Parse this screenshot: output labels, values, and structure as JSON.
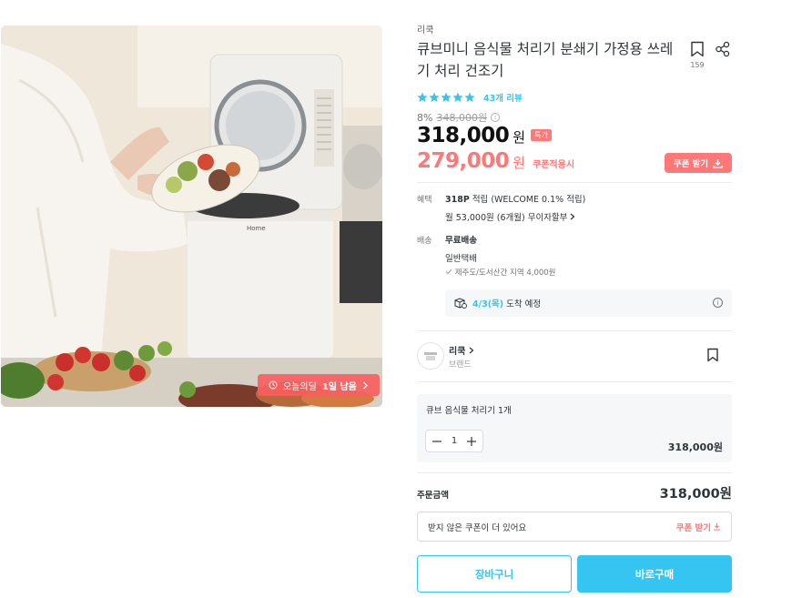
{
  "product": {
    "brand": "리쿡",
    "title": "큐브미니 음식물 처리기 분쇄기 가정용 쓰레기 처리 건조기",
    "scrap_count": "159",
    "review_label": "43개 리뷰",
    "rating": 5,
    "discount_rate": "8%",
    "original_price": "348,000원",
    "price": "318,000",
    "currency": "원",
    "special_badge": "특가",
    "coupon_price": "279,000",
    "coupon_applied_label": "쿠폰적용시",
    "coupon_button": "쿠폰 받기",
    "image_deal_badge": {
      "label": "오늘의딜",
      "remaining": "1일 남음"
    }
  },
  "benefit": {
    "label": "혜택",
    "points": "318P",
    "points_detail": " 적립 (WELCOME 0.1% 적립)",
    "installment": "월 53,000원 (6개월) 무이자할부"
  },
  "shipping": {
    "label": "배송",
    "fee": "무료배송",
    "method": "일반택배",
    "extra": "제주도/도서산간 지역 4,000원",
    "arrival_date": "4/3(목)",
    "arrival_text": "도착 예정"
  },
  "seller": {
    "name": "리쿡",
    "type": "브랜드"
  },
  "option": {
    "name": "큐브 음식물 처리기 1개",
    "quantity": "1",
    "price": "318,000원"
  },
  "order": {
    "label": "주문금액",
    "total": "318,000원",
    "unreceived_coupon_text": "받지 않은 쿠폰이 더 있어요",
    "unreceived_coupon_button": "쿠폰 받기"
  },
  "actions": {
    "cart": "장바구니",
    "buy": "바로구매"
  },
  "colors": {
    "accent": "#35c5f0",
    "coupon": "#ff7777",
    "text": "#2f3438"
  }
}
